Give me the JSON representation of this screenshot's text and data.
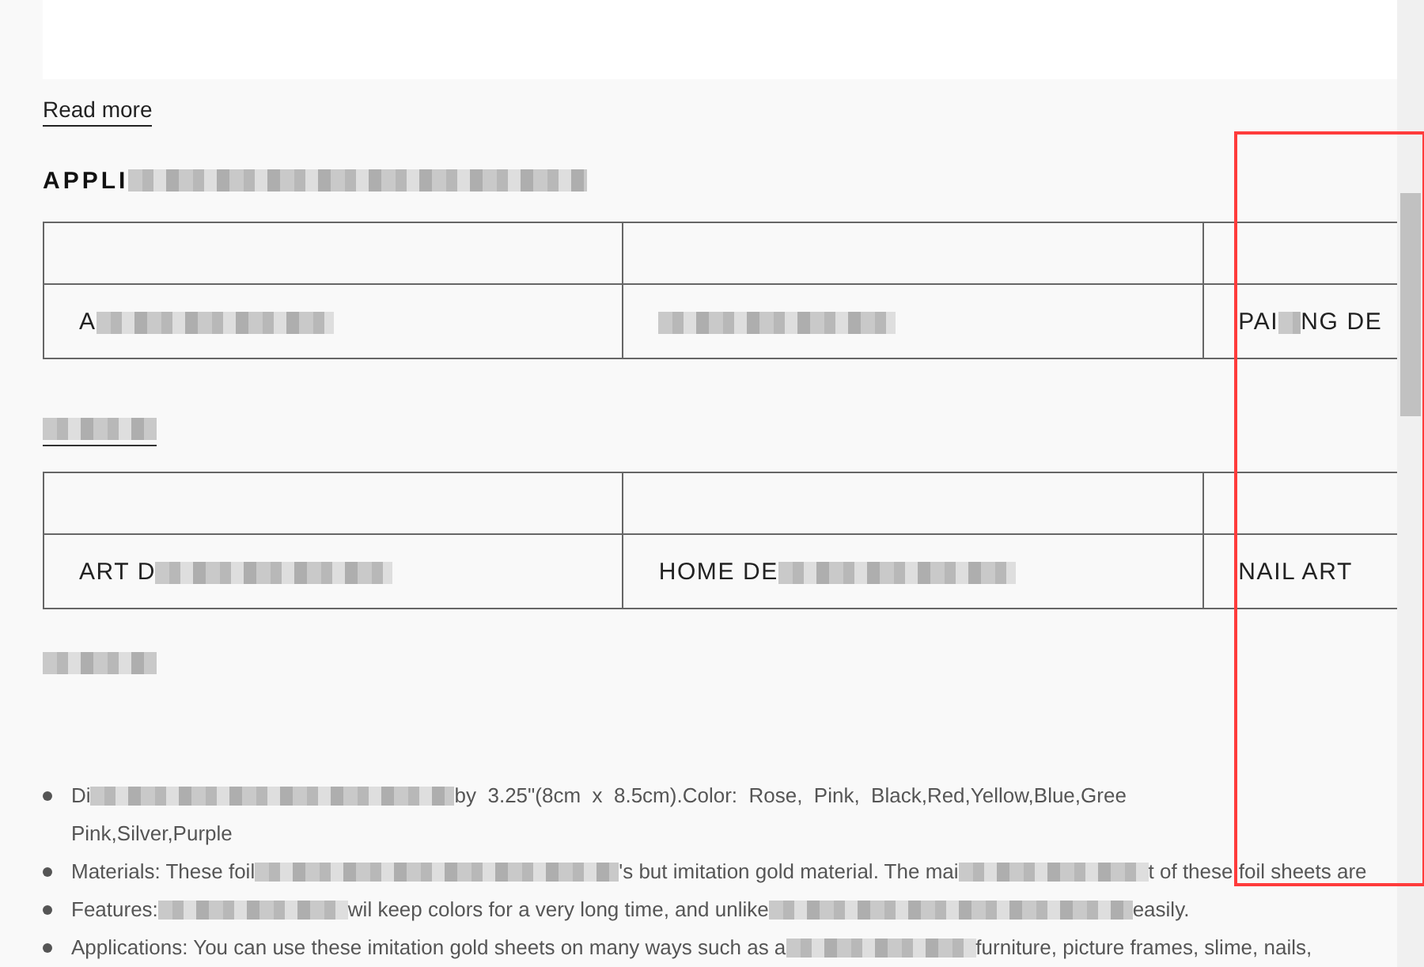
{
  "read_more": {
    "label": "Read more"
  },
  "sections": [
    {
      "heading": [
        {
          "kind": "text",
          "text": "APPLI"
        },
        {
          "kind": "mask-long"
        }
      ],
      "table": {
        "row": [
          [
            {
              "kind": "text",
              "text": "A"
            },
            {
              "kind": "mask"
            }
          ],
          [
            {
              "kind": "mask"
            }
          ],
          [
            {
              "kind": "text",
              "text": "PAI"
            },
            {
              "kind": "mask-short"
            },
            {
              "kind": "text",
              "text": "NG DE"
            }
          ]
        ]
      }
    },
    {
      "heading": [
        {
          "kind": "mask-short"
        }
      ],
      "table": {
        "row": [
          [
            {
              "kind": "text",
              "text": "ART D"
            },
            {
              "kind": "mask"
            }
          ],
          [
            {
              "kind": "text",
              "text": "HOME DE"
            },
            {
              "kind": "mask"
            }
          ],
          [
            {
              "kind": "text",
              "text": "NAIL ART"
            }
          ]
        ]
      }
    },
    {
      "heading": [
        {
          "kind": "mask-short"
        }
      ]
    }
  ],
  "bullets": [
    {
      "lines": [
        [
          {
            "kind": "text",
            "text": "Di"
          },
          {
            "kind": "mask-long"
          },
          {
            "kind": "text",
            "text": "by  3.25\"(8cm  x  8.5cm).Color:  Rose,  Pink,  Black,Red,Yellow,Blue,Gree"
          }
        ],
        [
          {
            "kind": "text",
            "text": "Pink,Silver,Purple"
          }
        ]
      ]
    },
    {
      "lines": [
        [
          {
            "kind": "text",
            "text": "Materials: These foil"
          },
          {
            "kind": "mask-long"
          },
          {
            "kind": "text",
            "text": "'s but imitation gold material. The mai"
          },
          {
            "kind": "mask"
          },
          {
            "kind": "text",
            "text": "t of these foil sheets are"
          }
        ]
      ]
    },
    {
      "lines": [
        [
          {
            "kind": "text",
            "text": "Features:"
          },
          {
            "kind": "mask"
          },
          {
            "kind": "text",
            "text": "wil keep colors for a very long time, and unlike"
          },
          {
            "kind": "mask-long"
          },
          {
            "kind": "text",
            "text": "easily."
          }
        ]
      ]
    },
    {
      "lines": [
        [
          {
            "kind": "text",
            "text": "Applications: You can use these imitation gold sheets on many ways such as a"
          },
          {
            "kind": "mask"
          },
          {
            "kind": "text",
            "text": "furniture, picture frames, slime, nails,"
          }
        ]
      ]
    }
  ],
  "annotation": {
    "kind": "rectangle"
  }
}
